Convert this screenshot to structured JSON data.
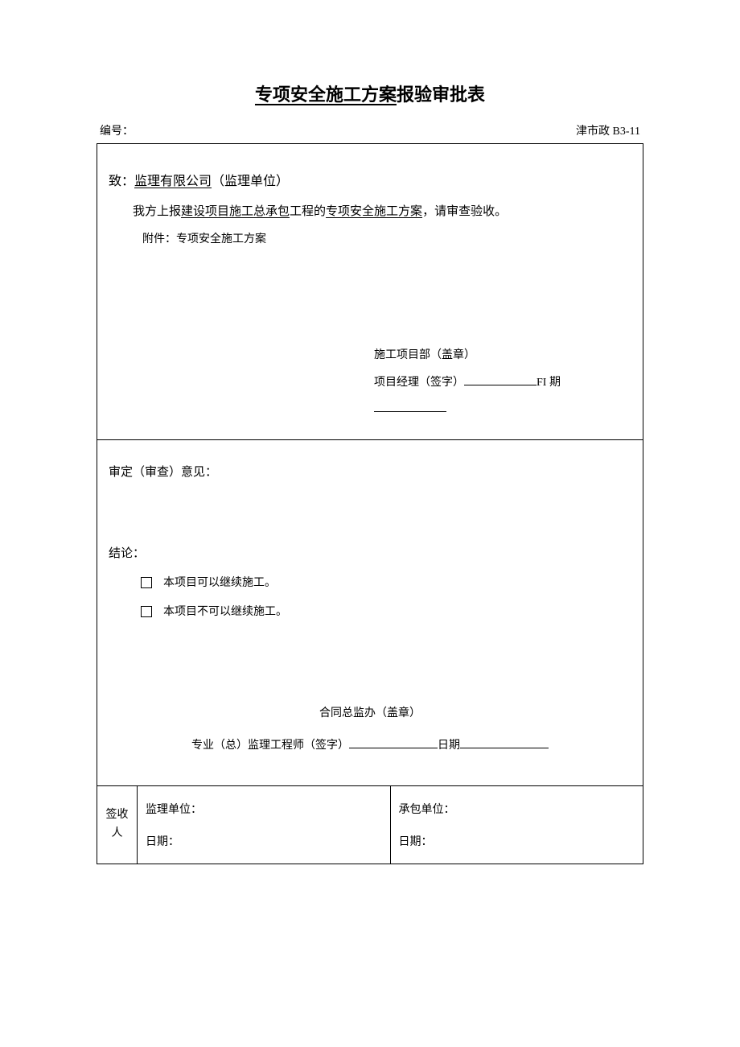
{
  "title_underlined": "专项安全施工方案",
  "title_tail": "报验审批表",
  "header": {
    "left_label": "编号：",
    "right_code": "津市政 B3-11"
  },
  "section1": {
    "to_prefix": "致：",
    "to_company": "监理有限公司",
    "to_suffix": "（监理单位）",
    "body_prefix": "我方上报",
    "body_mid": "建设项目施工总承包",
    "body_after_mid": "工程的",
    "body_item": "专项安全施工方案",
    "body_suffix": "，请审查验收。",
    "attachment": "附件：专项安全施工方案",
    "sig_dept": "施工项目部（盖章）",
    "sig_manager_label": "项目经理（签字）",
    "sig_date_label": "FI 期"
  },
  "section2": {
    "opinion_label": "审定（审查）意见：",
    "conclusion_label": "结论：",
    "checkbox1": "本项目可以继续施工。",
    "checkbox2": "本项目不可以继续施工。",
    "sig_office": "合同总监办（盖章）",
    "sig_engineer_label": "专业（总）监理工程师（签字）",
    "sig_date_label": "日期"
  },
  "section3": {
    "col_label_line1": "签收",
    "col_label_line2": "人",
    "supervisor_unit": "监理单位：",
    "supervisor_date": "日期：",
    "contractor_unit": "承包单位：",
    "contractor_date": "日期："
  }
}
